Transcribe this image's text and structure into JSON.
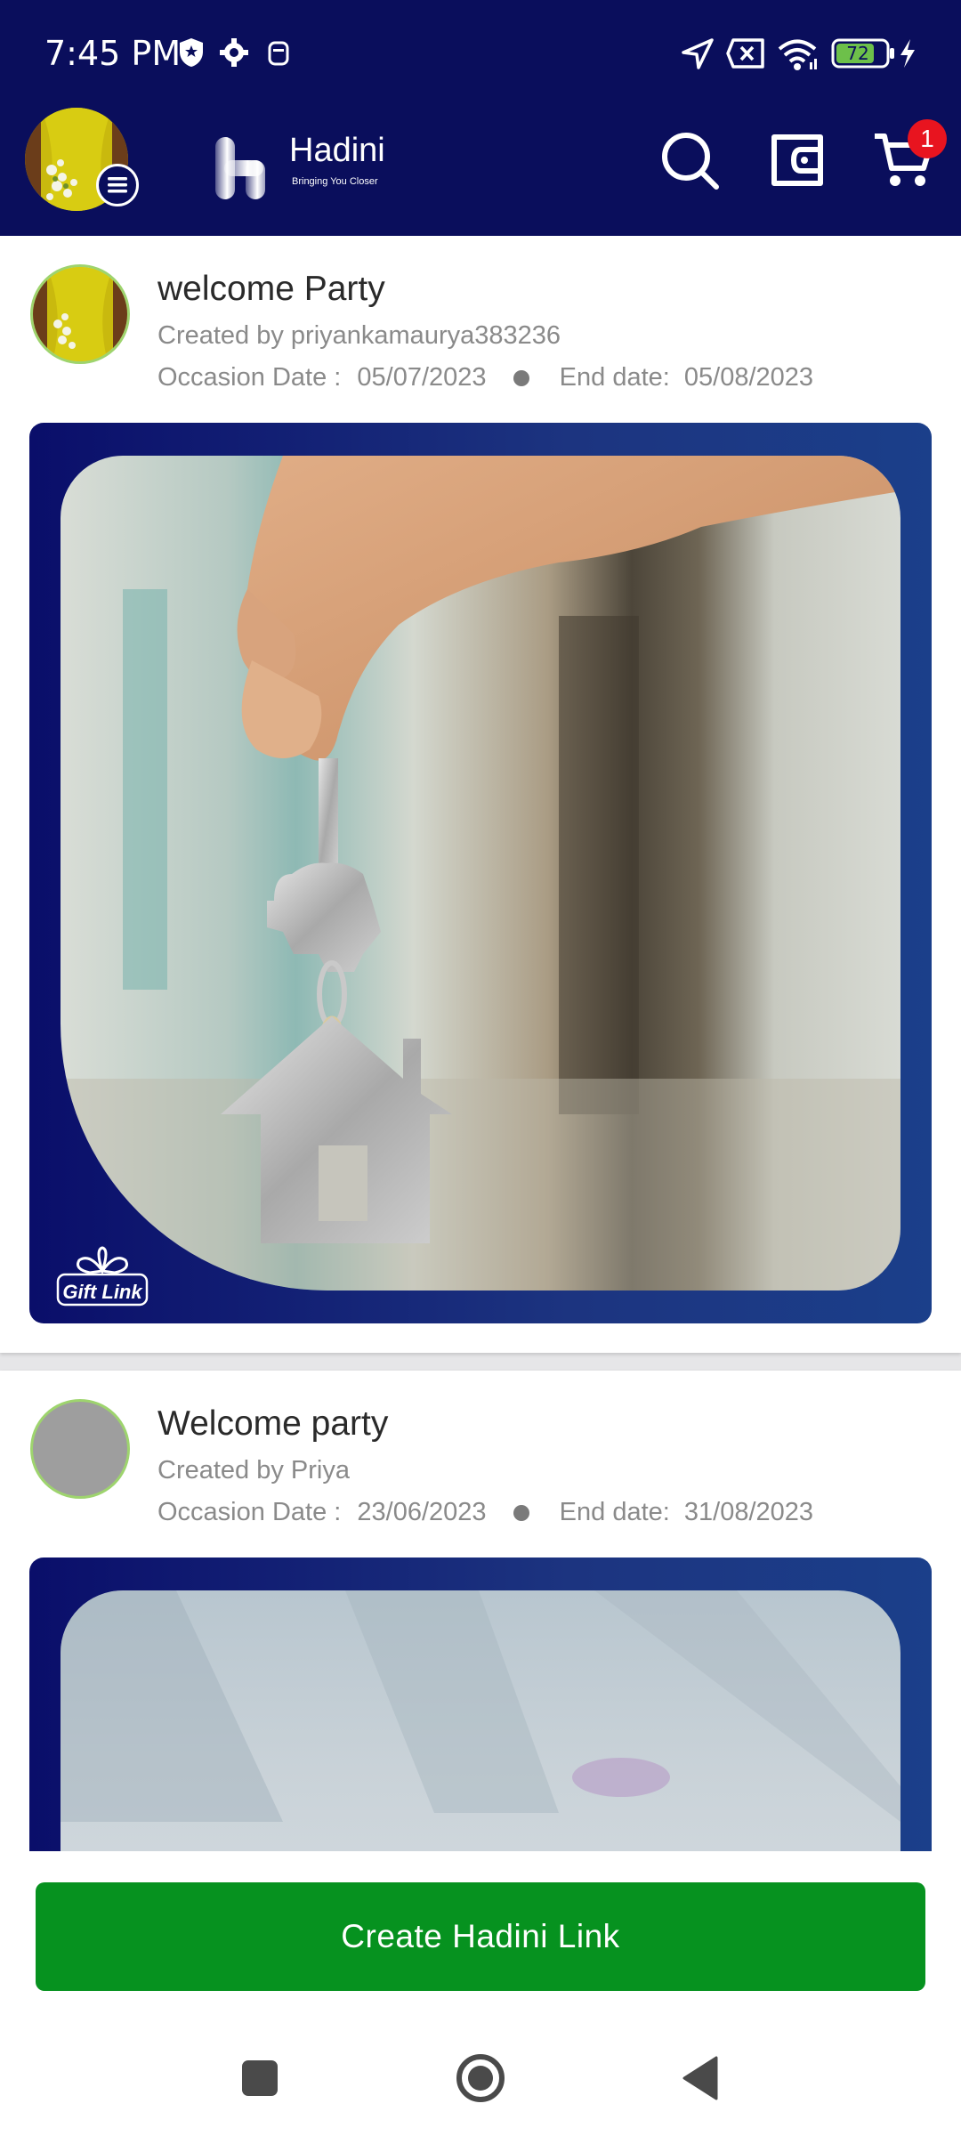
{
  "status_bar": {
    "time": "7:45 PM",
    "battery": "72",
    "icons": [
      "shield-icon",
      "gear-icon",
      "notification-icon",
      "location-arrow-icon",
      "sim-x-icon",
      "wifi-icon",
      "battery-icon",
      "charging-icon"
    ]
  },
  "app_bar": {
    "logo_name": "Hadini",
    "logo_tagline": "Bringing You Closer",
    "cart_count": "1",
    "icons": [
      "search-icon",
      "wallet-icon",
      "cart-icon"
    ]
  },
  "cards": [
    {
      "title": "welcome Party",
      "created_by": "Created by priyankamaurya383236",
      "occasion_label": "Occasion Date :",
      "occasion_date": "05/07/2023",
      "end_label": "End date:",
      "end_date": "05/08/2023",
      "watermark": "Gift Link"
    },
    {
      "title": "Welcome party",
      "created_by": "Created by Priya",
      "occasion_label": "Occasion Date :",
      "occasion_date": "23/06/2023",
      "end_label": "End date:",
      "end_date": "31/08/2023"
    }
  ],
  "cta": {
    "label": "Create Hadini Link"
  },
  "colors": {
    "header": "#0a0e5c",
    "cta": "#06921f",
    "badge": "#e8141f",
    "avatar_ring": "#9ed46e"
  },
  "nav": {
    "icons": [
      "recents-square-icon",
      "home-circle-icon",
      "back-triangle-icon"
    ]
  }
}
